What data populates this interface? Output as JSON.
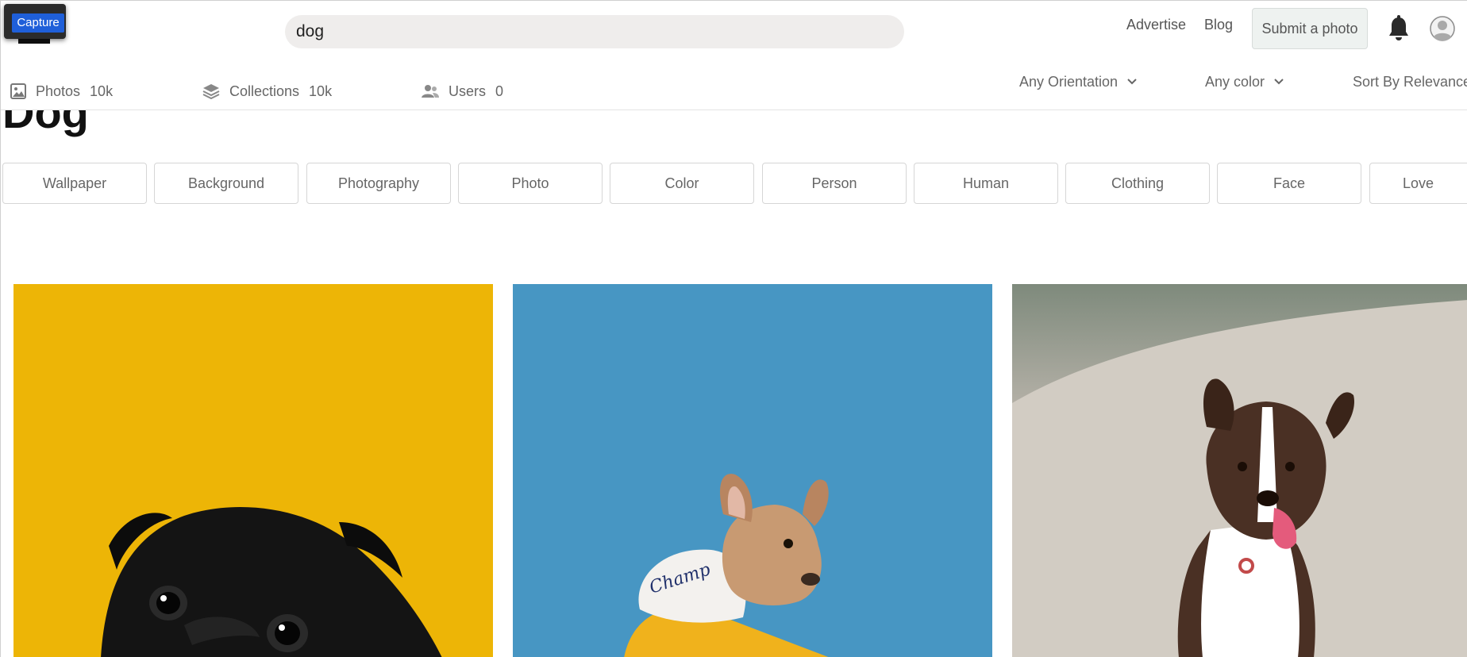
{
  "capture": {
    "label": "Capture"
  },
  "search": {
    "value": "dog",
    "placeholder": ""
  },
  "nav": {
    "advertise": "Advertise",
    "blog": "Blog",
    "submit": "Submit a photo"
  },
  "tabs": [
    {
      "label": "Photos",
      "count": "10k",
      "icon": "image-icon"
    },
    {
      "label": "Collections",
      "count": "10k",
      "icon": "layers-icon"
    },
    {
      "label": "Users",
      "count": "0",
      "icon": "users-icon"
    }
  ],
  "filters": {
    "orientation": "Any Orientation",
    "color": "Any color",
    "sort": "Sort By Relevance"
  },
  "heading": "Dog",
  "tags": [
    "Wallpaper",
    "Background",
    "Photography",
    "Photo",
    "Color",
    "Person",
    "Human",
    "Clothing",
    "Face",
    "Love"
  ],
  "photos": [
    {
      "subject": "black pug on yellow background",
      "bg": "#EDB506"
    },
    {
      "subject": "french bulldog in hoodie on blue background",
      "bg": "#4796C3"
    },
    {
      "subject": "australian shepherd running on sand",
      "bg": "#CBC5BD"
    }
  ],
  "colors": {
    "accent": "#1f5fd9",
    "search_bg": "#efedec",
    "submit_bg": "#eef2f0"
  }
}
